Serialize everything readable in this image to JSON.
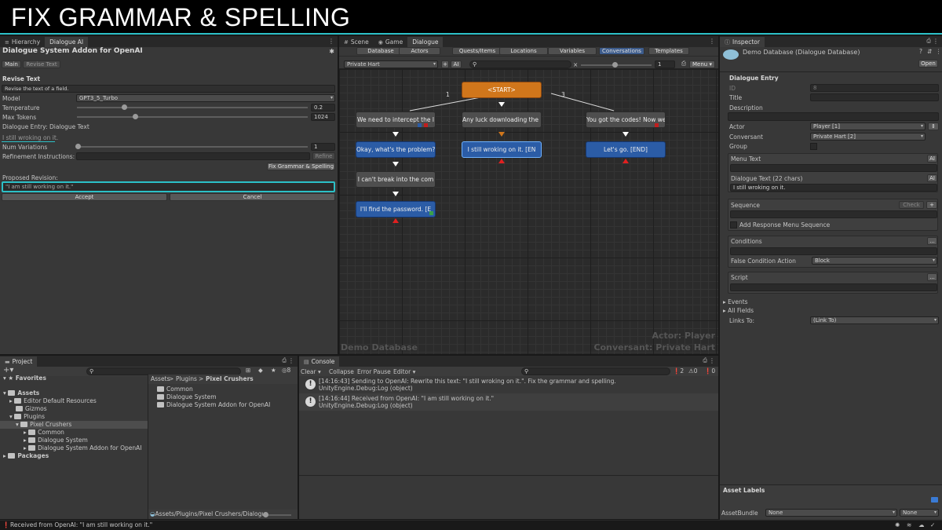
{
  "banner": {
    "title": "FIX GRAMMAR & SPELLING"
  },
  "left_panel": {
    "tabs": [
      "Hierarchy",
      "Dialogue AI"
    ],
    "title": "Dialogue System Addon for OpenAI",
    "subtabs": [
      "Main",
      "Revise Text"
    ],
    "section_title": "Revise Text",
    "section_desc": "Revise the text of a field.",
    "model_label": "Model",
    "model_value": "GPT3_5_Turbo",
    "temperature_label": "Temperature",
    "temperature_value": "0.2",
    "max_tokens_label": "Max Tokens",
    "max_tokens_value": "1024",
    "entry_label": "Dialogue Entry: Dialogue Text",
    "entry_text": "I still wroking on it.",
    "num_variations_label": "Num Variations",
    "num_variations_value": "1",
    "refinement_label": "Refinement Instructions:",
    "refine_button": "Refine",
    "fix_button": "Fix Grammar & Spelling",
    "proposed_label": "Proposed Revision:",
    "proposed_value": "\"I am still working on it.\"",
    "accept_button": "Accept",
    "cancel_button": "Cancel"
  },
  "center": {
    "tabs": [
      "Scene",
      "Game",
      "Dialogue"
    ],
    "db_tabs": [
      "Database",
      "Actors",
      "Quests/Items",
      "Locations",
      "Variables",
      "Conversations",
      "Templates"
    ],
    "active_db_tab": "Conversations",
    "conversation": "Private Hart",
    "plus_button": "+",
    "ai_button": "AI",
    "zoom_value": "1",
    "menu_button": "Menu",
    "nodes": {
      "start": "<START>",
      "n1": "We need to intercept the l",
      "n2": "Any luck downloading the l",
      "n3": "You got the codes! Now we",
      "n4": "Okay, what's the problem?",
      "n5": "I still wroking on it. [EN",
      "n6": "Let's go. [END]",
      "n7": "I can't break into the com",
      "n8": "I'll find the password. [E"
    },
    "link_labels": [
      "1",
      "3"
    ],
    "watermark_left": "Demo Database",
    "watermark_actor": "Actor: Player",
    "watermark_conversant": "Conversant: Private Hart"
  },
  "inspector": {
    "tab": "Inspector",
    "title": "Demo Database (Dialogue Database)",
    "open_button": "Open",
    "section": "Dialogue Entry",
    "id_label": "ID",
    "id_value": "8",
    "title_label": "Title",
    "description_label": "Description",
    "actor_label": "Actor",
    "actor_value": "Player [1]",
    "conversant_label": "Conversant",
    "conversant_value": "Private Hart [2]",
    "group_label": "Group",
    "menu_text_label": "Menu Text",
    "ai_label": "AI",
    "dialogue_text_label": "Dialogue Text (22 chars)",
    "dialogue_text_value": "I still wroking on it.",
    "sequence_label": "Sequence",
    "check_button": "Check",
    "plus": "+",
    "add_response_label": "Add Response Menu Sequence",
    "conditions_label": "Conditions",
    "ellipsis": "...",
    "false_condition_label": "False Condition Action",
    "false_condition_value": "Block",
    "script_label": "Script",
    "events_label": "Events",
    "all_fields_label": "All Fields",
    "links_to_label": "Links To:",
    "links_to_value": "(Link To)",
    "asset_labels": "Asset Labels",
    "asset_bundle_label": "AssetBundle",
    "asset_bundle_value": "None",
    "asset_variant_value": "None"
  },
  "project": {
    "tab": "Project",
    "favorites": "Favorites",
    "tree": [
      "Assets",
      "Editor Default Resources",
      "Gizmos",
      "Plugins",
      "Pixel Crushers",
      "Common",
      "Dialogue System",
      "Dialogue System Addon for OpenAI",
      "Packages"
    ],
    "breadcrumb": [
      "Assets",
      "Plugins",
      "Pixel Crushers"
    ],
    "files": [
      "Common",
      "Dialogue System",
      "Dialogue System Addon for OpenAI"
    ],
    "footer_path": "Assets/Plugins/Pixel Crushers/Dialogu",
    "count": "8"
  },
  "console": {
    "tab": "Console",
    "toolbar": [
      "Clear",
      "Collapse",
      "Error Pause",
      "Editor"
    ],
    "counts": {
      "log": "2",
      "warn": "0",
      "error": "0"
    },
    "logs": [
      {
        "line1": "[14:16:43] Sending to OpenAI: Rewrite this text: \"I still wroking on it.\". Fix the grammar and spelling.",
        "line2": "UnityEngine.Debug:Log (object)"
      },
      {
        "line1": "[14:16:44] Received from OpenAI: \"I am still working on it.\"",
        "line2": "UnityEngine.Debug:Log (object)"
      }
    ]
  },
  "status_bar": {
    "text": "Received from OpenAI: \"I am still working on it.\""
  },
  "colors": {
    "accent": "#2cc0c7",
    "node_blue": "#2b5ca6",
    "node_orange": "#d0761b",
    "tab_active": "#3d5c8c"
  }
}
